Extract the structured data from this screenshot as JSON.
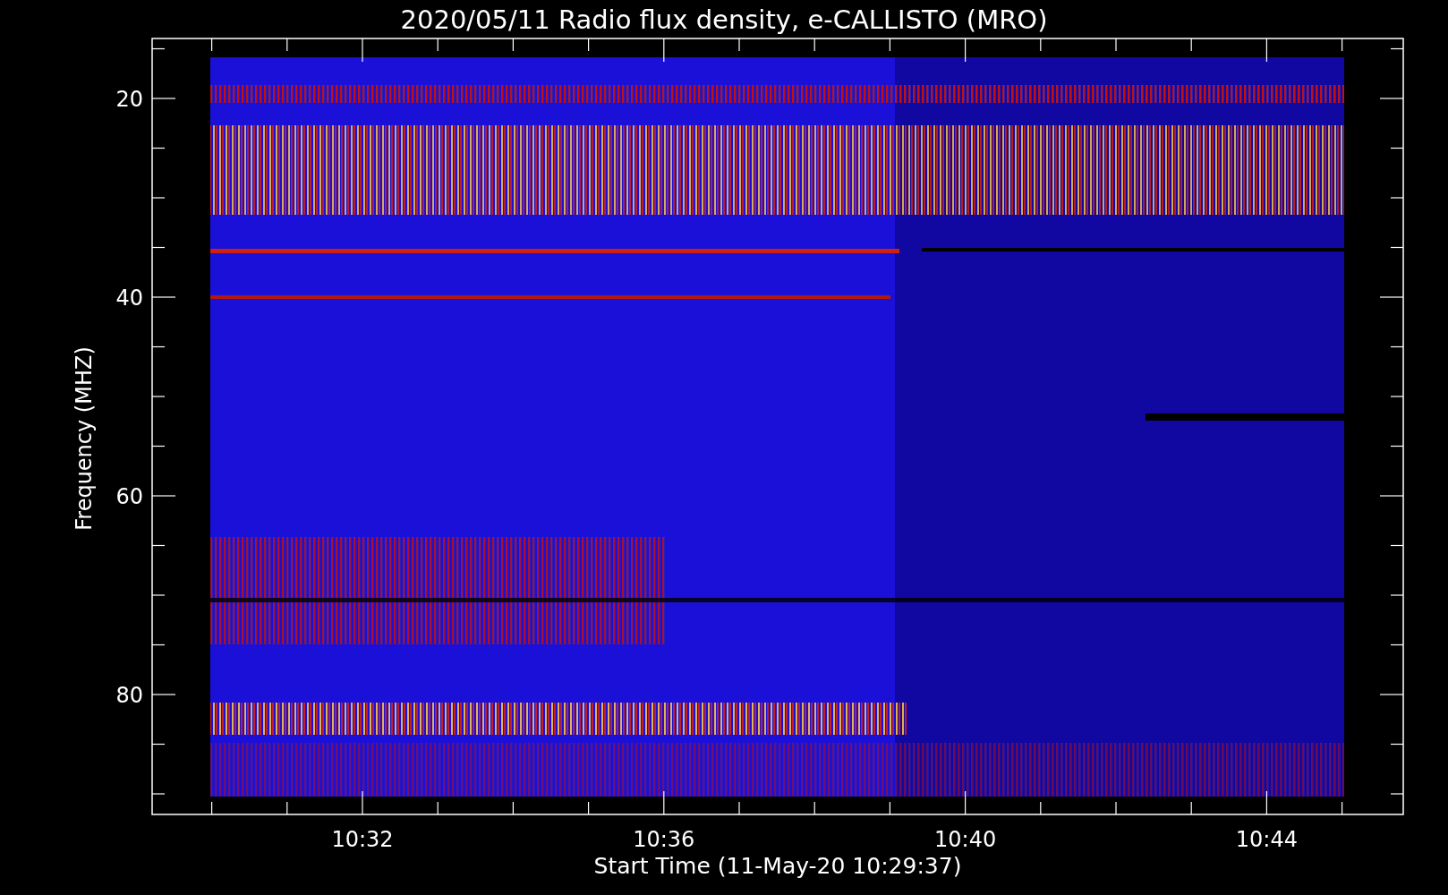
{
  "title": "2020/05/11  Radio flux density, e-CALLISTO (MRO)",
  "y_axis": {
    "label": "Frequency (MHZ)",
    "ticks": [
      "20",
      "40",
      "60",
      "80"
    ]
  },
  "x_axis": {
    "label": "Start Time (11-May-20 10:29:37)",
    "ticks": [
      "10:32",
      "10:36",
      "10:40",
      "10:44"
    ]
  }
}
